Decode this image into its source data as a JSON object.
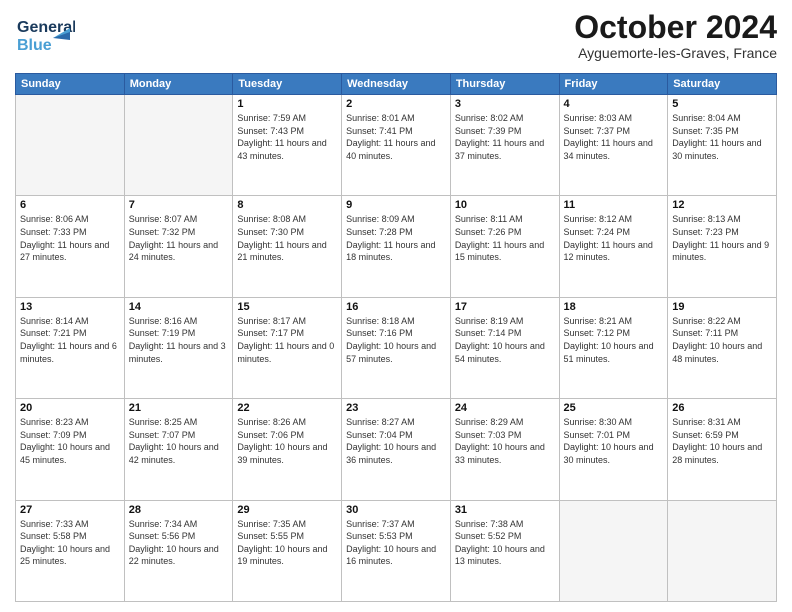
{
  "header": {
    "logo_line1": "General",
    "logo_line2": "Blue",
    "month": "October 2024",
    "location": "Ayguemorte-les-Graves, France"
  },
  "weekdays": [
    "Sunday",
    "Monday",
    "Tuesday",
    "Wednesday",
    "Thursday",
    "Friday",
    "Saturday"
  ],
  "weeks": [
    [
      {
        "day": "",
        "info": ""
      },
      {
        "day": "",
        "info": ""
      },
      {
        "day": "1",
        "info": "Sunrise: 7:59 AM\nSunset: 7:43 PM\nDaylight: 11 hours and 43 minutes."
      },
      {
        "day": "2",
        "info": "Sunrise: 8:01 AM\nSunset: 7:41 PM\nDaylight: 11 hours and 40 minutes."
      },
      {
        "day": "3",
        "info": "Sunrise: 8:02 AM\nSunset: 7:39 PM\nDaylight: 11 hours and 37 minutes."
      },
      {
        "day": "4",
        "info": "Sunrise: 8:03 AM\nSunset: 7:37 PM\nDaylight: 11 hours and 34 minutes."
      },
      {
        "day": "5",
        "info": "Sunrise: 8:04 AM\nSunset: 7:35 PM\nDaylight: 11 hours and 30 minutes."
      }
    ],
    [
      {
        "day": "6",
        "info": "Sunrise: 8:06 AM\nSunset: 7:33 PM\nDaylight: 11 hours and 27 minutes."
      },
      {
        "day": "7",
        "info": "Sunrise: 8:07 AM\nSunset: 7:32 PM\nDaylight: 11 hours and 24 minutes."
      },
      {
        "day": "8",
        "info": "Sunrise: 8:08 AM\nSunset: 7:30 PM\nDaylight: 11 hours and 21 minutes."
      },
      {
        "day": "9",
        "info": "Sunrise: 8:09 AM\nSunset: 7:28 PM\nDaylight: 11 hours and 18 minutes."
      },
      {
        "day": "10",
        "info": "Sunrise: 8:11 AM\nSunset: 7:26 PM\nDaylight: 11 hours and 15 minutes."
      },
      {
        "day": "11",
        "info": "Sunrise: 8:12 AM\nSunset: 7:24 PM\nDaylight: 11 hours and 12 minutes."
      },
      {
        "day": "12",
        "info": "Sunrise: 8:13 AM\nSunset: 7:23 PM\nDaylight: 11 hours and 9 minutes."
      }
    ],
    [
      {
        "day": "13",
        "info": "Sunrise: 8:14 AM\nSunset: 7:21 PM\nDaylight: 11 hours and 6 minutes."
      },
      {
        "day": "14",
        "info": "Sunrise: 8:16 AM\nSunset: 7:19 PM\nDaylight: 11 hours and 3 minutes."
      },
      {
        "day": "15",
        "info": "Sunrise: 8:17 AM\nSunset: 7:17 PM\nDaylight: 11 hours and 0 minutes."
      },
      {
        "day": "16",
        "info": "Sunrise: 8:18 AM\nSunset: 7:16 PM\nDaylight: 10 hours and 57 minutes."
      },
      {
        "day": "17",
        "info": "Sunrise: 8:19 AM\nSunset: 7:14 PM\nDaylight: 10 hours and 54 minutes."
      },
      {
        "day": "18",
        "info": "Sunrise: 8:21 AM\nSunset: 7:12 PM\nDaylight: 10 hours and 51 minutes."
      },
      {
        "day": "19",
        "info": "Sunrise: 8:22 AM\nSunset: 7:11 PM\nDaylight: 10 hours and 48 minutes."
      }
    ],
    [
      {
        "day": "20",
        "info": "Sunrise: 8:23 AM\nSunset: 7:09 PM\nDaylight: 10 hours and 45 minutes."
      },
      {
        "day": "21",
        "info": "Sunrise: 8:25 AM\nSunset: 7:07 PM\nDaylight: 10 hours and 42 minutes."
      },
      {
        "day": "22",
        "info": "Sunrise: 8:26 AM\nSunset: 7:06 PM\nDaylight: 10 hours and 39 minutes."
      },
      {
        "day": "23",
        "info": "Sunrise: 8:27 AM\nSunset: 7:04 PM\nDaylight: 10 hours and 36 minutes."
      },
      {
        "day": "24",
        "info": "Sunrise: 8:29 AM\nSunset: 7:03 PM\nDaylight: 10 hours and 33 minutes."
      },
      {
        "day": "25",
        "info": "Sunrise: 8:30 AM\nSunset: 7:01 PM\nDaylight: 10 hours and 30 minutes."
      },
      {
        "day": "26",
        "info": "Sunrise: 8:31 AM\nSunset: 6:59 PM\nDaylight: 10 hours and 28 minutes."
      }
    ],
    [
      {
        "day": "27",
        "info": "Sunrise: 7:33 AM\nSunset: 5:58 PM\nDaylight: 10 hours and 25 minutes."
      },
      {
        "day": "28",
        "info": "Sunrise: 7:34 AM\nSunset: 5:56 PM\nDaylight: 10 hours and 22 minutes."
      },
      {
        "day": "29",
        "info": "Sunrise: 7:35 AM\nSunset: 5:55 PM\nDaylight: 10 hours and 19 minutes."
      },
      {
        "day": "30",
        "info": "Sunrise: 7:37 AM\nSunset: 5:53 PM\nDaylight: 10 hours and 16 minutes."
      },
      {
        "day": "31",
        "info": "Sunrise: 7:38 AM\nSunset: 5:52 PM\nDaylight: 10 hours and 13 minutes."
      },
      {
        "day": "",
        "info": ""
      },
      {
        "day": "",
        "info": ""
      }
    ]
  ]
}
